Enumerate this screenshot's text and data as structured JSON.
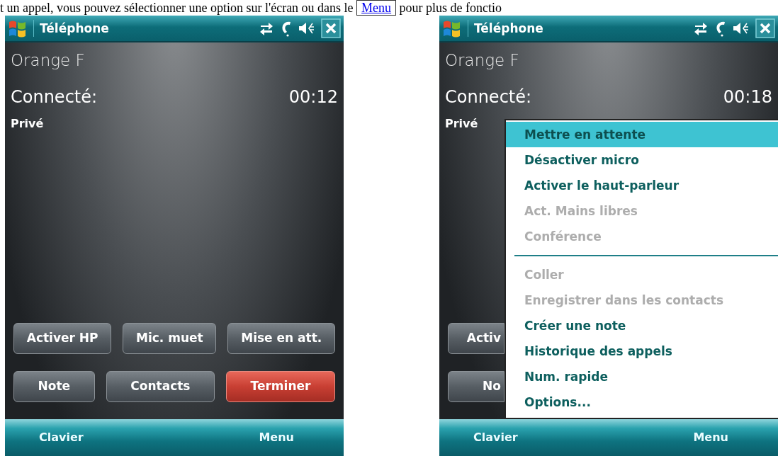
{
  "caption": {
    "before": "t un appel, vous pouvez sélectionner une option sur l'écran ou dans le ",
    "link": "Menu",
    "after": " pour plus de fonctio"
  },
  "phones": [
    {
      "title": "Téléphone",
      "carrier": "Orange F",
      "status_label": "Connecté:",
      "timer": "00:12",
      "privacy": "Privé",
      "button_rows": [
        [
          {
            "label": "Activer HP",
            "kind": "normal"
          },
          {
            "label": "Mic. muet",
            "kind": "normal"
          },
          {
            "label": "Mise en att.",
            "kind": "normal"
          }
        ],
        [
          {
            "label": "Note",
            "kind": "normal"
          },
          {
            "label": "Contacts",
            "kind": "normal"
          },
          {
            "label": "Terminer",
            "kind": "end"
          }
        ]
      ],
      "softkeys": {
        "left": "Clavier",
        "right": "Menu"
      }
    },
    {
      "title": "Téléphone",
      "carrier": "Orange F",
      "status_label": "Connecté:",
      "timer": "00:18",
      "privacy": "Privé",
      "button_rows": [
        [
          {
            "label": "Activ",
            "kind": "normal"
          }
        ],
        [
          {
            "label": "No",
            "kind": "normal"
          }
        ]
      ],
      "softkeys": {
        "left": "Clavier",
        "right": "Menu"
      },
      "menu": {
        "items": [
          {
            "kind": "item",
            "label": "Mettre en attente",
            "selected": true,
            "disabled": false
          },
          {
            "kind": "item",
            "label": "Désactiver micro",
            "selected": false,
            "disabled": false
          },
          {
            "kind": "item",
            "label": "Activer le haut-parleur",
            "selected": false,
            "disabled": false
          },
          {
            "kind": "item",
            "label": "Act. Mains libres",
            "selected": false,
            "disabled": true
          },
          {
            "kind": "item",
            "label": "Conférence",
            "selected": false,
            "disabled": true
          },
          {
            "kind": "separator"
          },
          {
            "kind": "item",
            "label": "Coller",
            "selected": false,
            "disabled": true
          },
          {
            "kind": "item",
            "label": "Enregistrer dans les contacts",
            "selected": false,
            "disabled": true
          },
          {
            "kind": "item",
            "label": "Créer une note",
            "selected": false,
            "disabled": false
          },
          {
            "kind": "item",
            "label": "Historique des appels",
            "selected": false,
            "disabled": false
          },
          {
            "kind": "item",
            "label": "Num. rapide",
            "selected": false,
            "disabled": false
          },
          {
            "kind": "item",
            "label": "Options...",
            "selected": false,
            "disabled": false
          }
        ]
      }
    }
  ]
}
